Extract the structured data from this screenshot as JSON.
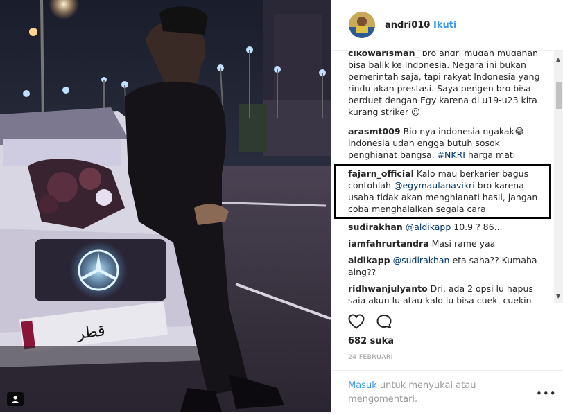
{
  "post": {
    "username": "andri010",
    "dot": "•",
    "follow_label": "Ikuti",
    "likes": "682 suka",
    "date": "24 FEBRUARI",
    "login_link": "Masuk",
    "login_text": " untuk menyukai atau mengomentari."
  },
  "plate_text": "قطر",
  "comments": [
    {
      "user": "cikowarisman_",
      "text": " bro andri mudah mudahan bisa balik ke Indonesia. Negara ini bukan pemerintah saja, tapi rakyat Indonesia yang rindu akan prestasi. Saya pengen bro bisa berduet dengan Egy karena di u19-u23 kita kurang striker ☺"
    },
    {
      "user": "arasmt009",
      "text": " Bio nya indonesia ngakak😂 indonesia udah engga butuh sosok penghianat bangsa. ",
      "mention": "#NKRI",
      "after": " harga mati"
    },
    {
      "user": "fajarn_official",
      "text": " Kalo mau berkarier bagus contohlah ",
      "mention": "@egymaulanavikri",
      "after": " bro karena usaha tidak akan menghianati hasil, jangan coba menghalalkan segala cara"
    },
    {
      "user": "sudirakhan",
      "text": " ",
      "mention": "@aldikapp",
      "after": " 10.9 ? 86..."
    },
    {
      "user": "iamfahrurtandra",
      "text": " Masi rame yaa"
    },
    {
      "user": "aldikapp",
      "text": " ",
      "mention": "@sudirakhan",
      "after": " eta saha?? Kumaha aing??"
    },
    {
      "user": "ridhwanjulyanto",
      "text": " Dri, ada 2 opsi lu hapus saja akun lu atau kalo lu bisa cuek, cuekin"
    }
  ],
  "icons": {
    "like": "heart-icon",
    "comment": "comment-bubble-icon",
    "more": "more-options-icon",
    "user_tag": "user-tag-icon"
  },
  "colors": {
    "link": "#3897f0",
    "text": "#262626",
    "muted": "#999999",
    "highlight_box": "#000000"
  }
}
